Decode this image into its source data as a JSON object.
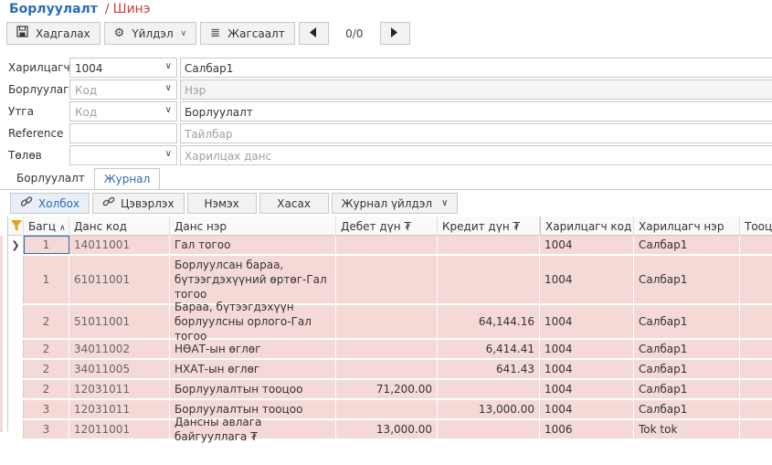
{
  "header": {
    "title": "Борлуулалт",
    "separator": "/",
    "subtitle": "Шинэ"
  },
  "toolbar": {
    "save_label": "Хадгалах",
    "actions_label": "Үйлдэл",
    "list_label": "Жагсаалт",
    "prev_icon": "triangle-left-icon",
    "next_icon": "triangle-right-icon",
    "counter": "0/0"
  },
  "form": {
    "partner": {
      "label": "Харилцагч",
      "value": "1004",
      "name_value": "Салбар1"
    },
    "seller": {
      "label": "Борлуулагч",
      "placeholder": "Код",
      "name_placeholder": "Нэр"
    },
    "type": {
      "label": "Утга",
      "placeholder": "Код",
      "name_value": "Борлуулалт"
    },
    "reference": {
      "label": "Reference",
      "value": "",
      "desc_placeholder": "Тайлбар"
    },
    "payment": {
      "label": "Төлөв",
      "value": "",
      "account_placeholder": "Харилцах данс"
    }
  },
  "tabs": [
    {
      "label": "Борлуулалт"
    },
    {
      "label": "Журнал"
    }
  ],
  "grid_toolbar": {
    "link_label": "Холбох",
    "clear_label": "Цэвэрлэх",
    "add_label": "Нэмэх",
    "delete_label": "Хасах",
    "journal_label": "Журнал үйлдэл"
  },
  "grid": {
    "columns": [
      "Багц",
      "Данс код",
      "Данс нэр",
      "Дебет дүн ₮",
      "Кредит дүн ₮",
      "Харилцагч код",
      "Харилцагч нэр",
      "Тооцо"
    ],
    "rows": [
      {
        "batch": "1",
        "code": "14011001",
        "name": "Гал тогоо",
        "debit": "",
        "credit": "",
        "pcode": "1004",
        "pname": "Салбар1"
      },
      {
        "batch": "1",
        "code": "61011001",
        "name": "Борлуулсан бараа, бүтээгдэхүүний өртөг-Гал тогоо",
        "debit": "",
        "credit": "",
        "pcode": "1004",
        "pname": "Салбар1"
      },
      {
        "batch": "2",
        "code": "51011001",
        "name": "Бараа, бүтээгдэхүүн борлуулсны орлого-Гал тогоо",
        "debit": "",
        "credit": "64,144.16",
        "pcode": "1004",
        "pname": "Салбар1"
      },
      {
        "batch": "2",
        "code": "34011002",
        "name": "НӨАТ-ын өглөг",
        "debit": "",
        "credit": "6,414.41",
        "pcode": "1004",
        "pname": "Салбар1"
      },
      {
        "batch": "2",
        "code": "34011005",
        "name": "НХАТ-ын өглөг",
        "debit": "",
        "credit": "641.43",
        "pcode": "1004",
        "pname": "Салбар1"
      },
      {
        "batch": "2",
        "code": "12031011",
        "name": "Борлуулалтын тооцоо",
        "debit": "71,200.00",
        "credit": "",
        "pcode": "1004",
        "pname": "Салбар1"
      },
      {
        "batch": "3",
        "code": "12031011",
        "name": "Борлуулалтын тооцоо",
        "debit": "",
        "credit": "13,000.00",
        "pcode": "1004",
        "pname": "Салбар1"
      },
      {
        "batch": "3",
        "code": "12011001",
        "name": "Дансны авлага байгууллага ₮",
        "debit": "13,000.00",
        "credit": "",
        "pcode": "1006",
        "pname": "Tok tok"
      }
    ]
  }
}
